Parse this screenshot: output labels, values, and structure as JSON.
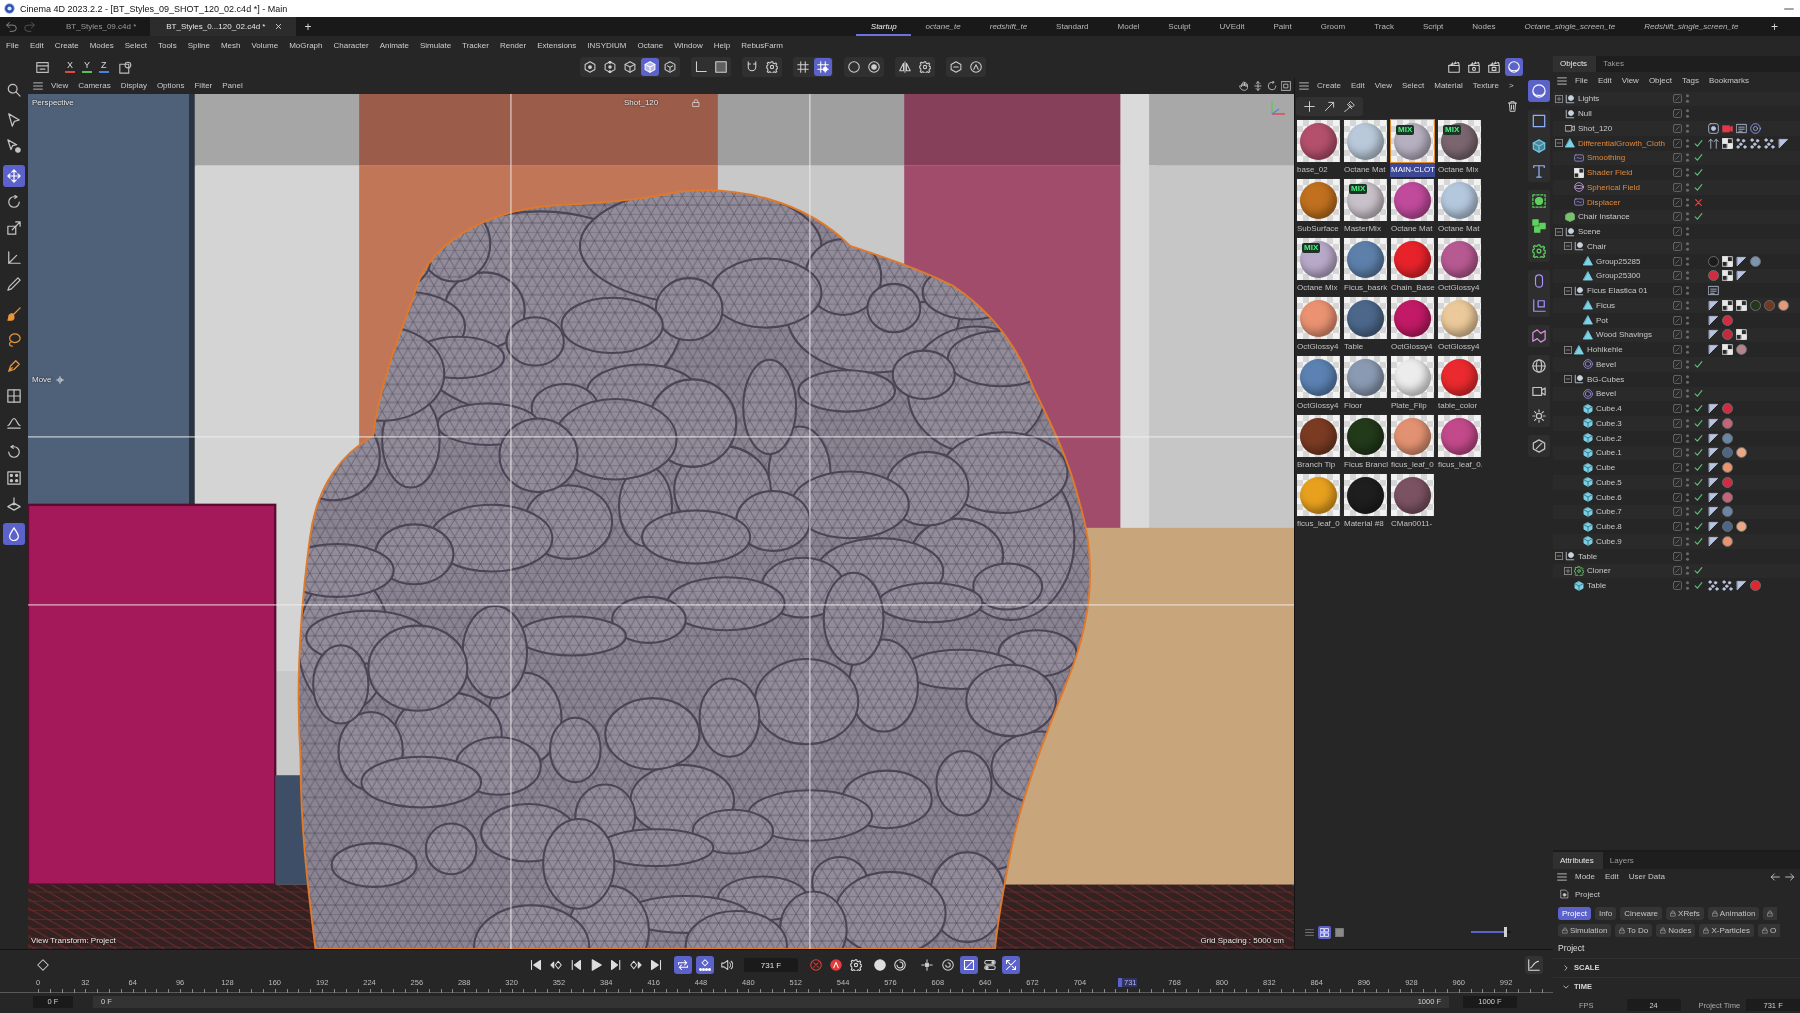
{
  "window": {
    "title": "Cinema 4D 2023.2.2 - [BT_Styles_09_SHOT_120_02.c4d *] - Main"
  },
  "documents": [
    {
      "label": "BT_Styles_09.c4d *",
      "selected": false
    },
    {
      "label": "BT_Styles_0...120_02.c4d *",
      "selected": true
    }
  ],
  "new_document": "+",
  "layouts": [
    {
      "label": "Startup",
      "selected": true,
      "custom": false
    },
    {
      "label": "octane_te",
      "selected": false,
      "custom": true
    },
    {
      "label": "redshift_te",
      "selected": false,
      "custom": true
    },
    {
      "label": "Standard",
      "selected": false,
      "custom": false
    },
    {
      "label": "Model",
      "selected": false,
      "custom": false
    },
    {
      "label": "Sculpt",
      "selected": false,
      "custom": false
    },
    {
      "label": "UVEdit",
      "selected": false,
      "custom": false
    },
    {
      "label": "Paint",
      "selected": false,
      "custom": false
    },
    {
      "label": "Groom",
      "selected": false,
      "custom": false
    },
    {
      "label": "Track",
      "selected": false,
      "custom": false
    },
    {
      "label": "Script",
      "selected": false,
      "custom": false
    },
    {
      "label": "Nodes",
      "selected": false,
      "custom": false
    },
    {
      "label": "Octane_single_screen_te",
      "selected": false,
      "custom": true
    },
    {
      "label": "Redshift_single_screen_te",
      "selected": false,
      "custom": true
    }
  ],
  "new_layout": "+",
  "menu": [
    "File",
    "Edit",
    "Create",
    "Modes",
    "Select",
    "Tools",
    "Spline",
    "Mesh",
    "Volume",
    "MoGraph",
    "Character",
    "Animate",
    "Simulate",
    "Tracker",
    "Render",
    "Extensions",
    "INSYDIUM",
    "Octane",
    "Window",
    "Help",
    "RebusFarm"
  ],
  "toolbar": {
    "axes": [
      {
        "label": "X",
        "color": "#e04848"
      },
      {
        "label": "Y",
        "color": "#58c058"
      },
      {
        "label": "Z",
        "color": "#4a80e0"
      }
    ],
    "tool_groups": [
      [
        {
          "selected": false
        },
        {
          "selected": false
        },
        {
          "selected": false
        },
        {
          "selected": true
        },
        {
          "selected": false
        }
      ],
      [
        {
          "selected": false
        },
        {
          "selected": false
        }
      ],
      [
        {
          "selected": false
        },
        {
          "selected": false
        }
      ],
      [
        {
          "selected": false
        },
        {
          "selected": true
        }
      ],
      [
        {
          "selected": false
        },
        {
          "selected": false
        }
      ],
      [
        {
          "selected": false
        },
        {
          "selected": false
        }
      ],
      [
        {
          "selected": false
        },
        {
          "selected": false
        }
      ]
    ],
    "render_tools": [
      {
        "selected": false
      },
      {
        "selected": false
      },
      {
        "selected": false
      },
      {
        "selected": true
      }
    ]
  },
  "left_tools": [
    [
      {
        "selected": false
      }
    ],
    [
      {
        "selected": false
      },
      {
        "selected": false
      }
    ],
    [
      {
        "selected": true
      },
      {
        "selected": false
      },
      {
        "selected": false
      }
    ],
    [
      {
        "selected": false
      },
      {
        "selected": false
      }
    ],
    [
      {
        "selected": false
      },
      {
        "selected": false
      },
      {
        "selected": false
      }
    ],
    [
      {
        "selected": false
      },
      {
        "selected": false
      }
    ],
    [
      {
        "selected": false
      },
      {
        "selected": false
      },
      {
        "selected": false
      }
    ],
    [
      {
        "selected": true
      }
    ]
  ],
  "viewport": {
    "menu": [
      "View",
      "Cameras",
      "Display",
      "Options",
      "Filter",
      "Panel"
    ],
    "camera": "Perspective",
    "shot": "Shot_120",
    "tool": "Move",
    "view_transform": "View Transform: Project",
    "grid_spacing": "Grid Spacing : 5000 cm"
  },
  "materials": {
    "menu": [
      "Create",
      "Edit",
      "View",
      "Select",
      "Material",
      "Texture",
      ">"
    ],
    "items": [
      {
        "name": "base_02",
        "color": "#b4506c",
        "selected": false
      },
      {
        "name": "Octane Mat",
        "color": "#b9c9d9",
        "selected": false
      },
      {
        "name": "MAIN-CLOT",
        "color": "#b5afbf",
        "badge": "MIX",
        "selected": true
      },
      {
        "name": "Octane Mix",
        "color": "#7b6670",
        "badge": "MIX",
        "selected": false
      },
      {
        "name": "SubSurface",
        "color": "#c0701e",
        "selected": false
      },
      {
        "name": "MasterMix",
        "color": "#c9c1c9",
        "badge": "MIX",
        "selected": false
      },
      {
        "name": "Octane Mat",
        "color": "#c04a9c",
        "selected": false
      },
      {
        "name": "Octane Mat",
        "color": "#b3c7dd",
        "selected": false
      },
      {
        "name": "Octane Mix",
        "color": "#b9a9c9",
        "badge": "MIX",
        "selected": false
      },
      {
        "name": "Ficus_basrk",
        "color": "#5d80aa",
        "selected": false
      },
      {
        "name": "Chain_Base",
        "color": "#e8222a",
        "selected": false
      },
      {
        "name": "OctGlossy4",
        "color": "#b85a92",
        "selected": false
      },
      {
        "name": "OctGlossy4",
        "color": "#ea9272",
        "selected": false
      },
      {
        "name": "Table",
        "color": "#4b678a",
        "selected": false
      },
      {
        "name": "OctGlossy4",
        "color": "#c21a66",
        "selected": false
      },
      {
        "name": "OctGlossy4",
        "color": "#ebc99a",
        "selected": false
      },
      {
        "name": "OctGlossy4",
        "color": "#5b82b2",
        "selected": false
      },
      {
        "name": "Floor",
        "color": "#8a9ab2",
        "selected": false
      },
      {
        "name": "Plate_Flip",
        "color": "#ececec",
        "selected": false
      },
      {
        "name": "table_color",
        "color": "#ea2a2e",
        "selected": false
      },
      {
        "name": "Branch Tip",
        "color": "#7a3b22",
        "selected": false
      },
      {
        "name": "Ficus Brancl",
        "color": "#22391a",
        "selected": false
      },
      {
        "name": "ficus_leaf_0",
        "color": "#e29272",
        "selected": false
      },
      {
        "name": "ficus_leaf_0.",
        "color": "#c24a8a",
        "selected": false
      },
      {
        "name": "ficus_leaf_0",
        "color": "#e8a11e",
        "selected": false
      },
      {
        "name": "Material #8",
        "color": "#1e1e1e",
        "selected": false
      },
      {
        "name": "CMan0011-",
        "color": "#7b5262",
        "selected": false
      }
    ],
    "view_modes": [
      {
        "selected": false
      },
      {
        "selected": true
      },
      {
        "selected": false
      }
    ],
    "thumbnail_size": {
      "level": 0.85
    }
  },
  "right_tools": [
    [
      {
        "selected": true
      }
    ],
    [
      {
        "selected": false
      },
      {
        "selected": false
      },
      {
        "selected": false
      }
    ],
    [
      {
        "selected": false
      },
      {
        "selected": false
      },
      {
        "selected": false
      }
    ],
    [
      {
        "selected": false
      },
      {
        "selected": false
      }
    ],
    [
      {
        "selected": false
      }
    ],
    [
      {
        "selected": false
      },
      {
        "selected": false
      },
      {
        "selected": false
      }
    ],
    [
      {
        "selected": false
      }
    ]
  ],
  "objects": {
    "tabs": [
      {
        "label": "Objects",
        "selected": true
      },
      {
        "label": "Takes",
        "selected": false
      }
    ],
    "menu": [
      "File",
      "Edit",
      "View",
      "Object",
      "Tags",
      "Bookmarks"
    ],
    "tree": [
      {
        "name": "Lights",
        "kind": "null",
        "expanded": false,
        "selected": false
      },
      {
        "name": "Null",
        "kind": "null",
        "selected": false
      },
      {
        "name": "Shot_120",
        "kind": "camera",
        "selected": false,
        "tags": [
          {
            "kind": "target"
          },
          {
            "kind": "camera"
          },
          {
            "kind": "note"
          },
          {
            "kind": "ring"
          }
        ]
      },
      {
        "name": "DifferentialGrowth_Cloth",
        "kind": "mesh",
        "expanded": true,
        "selected": true,
        "enabled": true,
        "tags": [
          {
            "kind": "arrows"
          },
          {
            "kind": "checker"
          },
          {
            "kind": "dots"
          },
          {
            "kind": "dots"
          },
          {
            "kind": "dots"
          },
          {
            "kind": "triangle"
          }
        ],
        "children": [
          {
            "name": "Smoothing",
            "kind": "deformer",
            "selected": true,
            "enabled": true
          },
          {
            "name": "Shader Field",
            "kind": "checkerfield",
            "selected": true,
            "enabled": true
          },
          {
            "name": "Spherical Field",
            "kind": "spherefield",
            "selected": true,
            "enabled": true
          },
          {
            "name": "Displacer",
            "kind": "deformer",
            "selected": true,
            "enabled": false
          }
        ]
      },
      {
        "name": "Chair Instance",
        "kind": "instance",
        "selected": false,
        "enabled": true
      },
      {
        "name": "Scene",
        "kind": "null",
        "expanded": true,
        "selected": false,
        "children": [
          {
            "name": "Chair",
            "kind": "null",
            "expanded": true,
            "selected": false,
            "children": [
              {
                "name": "Group25285",
                "kind": "mesh",
                "selected": false,
                "tags": [
                  {
                    "kind": "material",
                    "color": "#1c1c1c"
                  },
                  {
                    "kind": "checker"
                  },
                  {
                    "kind": "triangle"
                  },
                  {
                    "kind": "material",
                    "color": "#7c94ac"
                  }
                ]
              },
              {
                "name": "Group25300",
                "kind": "mesh",
                "selected": false,
                "tags": [
                  {
                    "kind": "material",
                    "color": "#d42a40"
                  },
                  {
                    "kind": "checker"
                  },
                  {
                    "kind": "triangle"
                  }
                ]
              }
            ]
          },
          {
            "name": "Ficus Elastica 01",
            "kind": "null",
            "expanded": true,
            "selected": false,
            "tags": [
              {
                "kind": "note"
              }
            ],
            "children": [
              {
                "name": "Ficus",
                "kind": "mesh",
                "selected": false,
                "tags": [
                  {
                    "kind": "triangle"
                  },
                  {
                    "kind": "checker"
                  },
                  {
                    "kind": "checker"
                  },
                  {
                    "kind": "material",
                    "color": "#24361e"
                  },
                  {
                    "kind": "material",
                    "color": "#6e3a22"
                  },
                  {
                    "kind": "material",
                    "color": "#e29a78"
                  }
                ]
              },
              {
                "name": "Pot",
                "kind": "mesh",
                "selected": false,
                "tags": [
                  {
                    "kind": "triangle"
                  },
                  {
                    "kind": "material",
                    "color": "#d42a40"
                  }
                ]
              },
              {
                "name": "Wood Shavings",
                "kind": "mesh",
                "selected": false,
                "tags": [
                  {
                    "kind": "triangle"
                  },
                  {
                    "kind": "material",
                    "color": "#c8283c"
                  },
                  {
                    "kind": "checker"
                  }
                ]
              }
            ]
          },
          {
            "name": "Hohlkehle",
            "kind": "mesh",
            "expanded": true,
            "selected": false,
            "tags": [
              {
                "kind": "triangle"
              },
              {
                "kind": "checker"
              },
              {
                "kind": "material",
                "color": "#b4848a"
              }
            ],
            "children": [
              {
                "name": "Bevel",
                "kind": "bevel",
                "selected": false,
                "enabled": true
              }
            ]
          },
          {
            "name": "BG-Cubes",
            "kind": "null",
            "expanded": true,
            "selected": false,
            "children": [
              {
                "name": "Bevel",
                "kind": "bevel",
                "selected": false,
                "enabled": true
              },
              {
                "name": "Cube.4",
                "kind": "cube",
                "selected": false,
                "enabled": true,
                "tags": [
                  {
                    "kind": "triangle"
                  },
                  {
                    "kind": "material",
                    "color": "#d22a44"
                  }
                ]
              },
              {
                "name": "Cube.3",
                "kind": "cube",
                "selected": false,
                "enabled": true,
                "tags": [
                  {
                    "kind": "triangle"
                  },
                  {
                    "kind": "material",
                    "color": "#c46478"
                  }
                ]
              },
              {
                "name": "Cube.2",
                "kind": "cube",
                "selected": false,
                "enabled": true,
                "tags": [
                  {
                    "kind": "triangle"
                  },
                  {
                    "kind": "material",
                    "color": "#6a86a6"
                  }
                ]
              },
              {
                "name": "Cube.1",
                "kind": "cube",
                "selected": false,
                "enabled": true,
                "tags": [
                  {
                    "kind": "triangle"
                  },
                  {
                    "kind": "material",
                    "color": "#4c6686"
                  },
                  {
                    "kind": "material",
                    "color": "#eaa884"
                  }
                ]
              },
              {
                "name": "Cube",
                "kind": "cube",
                "selected": false,
                "enabled": true,
                "tags": [
                  {
                    "kind": "triangle"
                  },
                  {
                    "kind": "material",
                    "color": "#e8946e"
                  }
                ]
              },
              {
                "name": "Cube.5",
                "kind": "cube",
                "selected": false,
                "enabled": true,
                "tags": [
                  {
                    "kind": "triangle"
                  },
                  {
                    "kind": "material",
                    "color": "#d22a44"
                  }
                ]
              },
              {
                "name": "Cube.6",
                "kind": "cube",
                "selected": false,
                "enabled": true,
                "tags": [
                  {
                    "kind": "triangle"
                  },
                  {
                    "kind": "material",
                    "color": "#c46478"
                  }
                ]
              },
              {
                "name": "Cube.7",
                "kind": "cube",
                "selected": false,
                "enabled": true,
                "tags": [
                  {
                    "kind": "triangle"
                  },
                  {
                    "kind": "material",
                    "color": "#6a86a6"
                  }
                ]
              },
              {
                "name": "Cube.8",
                "kind": "cube",
                "selected": false,
                "enabled": true,
                "tags": [
                  {
                    "kind": "triangle"
                  },
                  {
                    "kind": "material",
                    "color": "#4c6686"
                  },
                  {
                    "kind": "material",
                    "color": "#eaa884"
                  }
                ]
              },
              {
                "name": "Cube.9",
                "kind": "cube",
                "selected": false,
                "enabled": true,
                "tags": [
                  {
                    "kind": "triangle"
                  },
                  {
                    "kind": "material",
                    "color": "#e8946e"
                  }
                ]
              }
            ]
          }
        ]
      },
      {
        "name": "Table",
        "kind": "null",
        "expanded": true,
        "selected": false,
        "children": [
          {
            "name": "Cloner",
            "kind": "cloner",
            "expanded": false,
            "selected": false,
            "enabled": true
          },
          {
            "name": "Table",
            "kind": "cube",
            "selected": false,
            "enabled": true,
            "tags": [
              {
                "kind": "dots"
              },
              {
                "kind": "dots"
              },
              {
                "kind": "triangle"
              },
              {
                "kind": "material",
                "color": "#e0262e"
              }
            ]
          }
        ]
      }
    ]
  },
  "attributes": {
    "tabs": [
      {
        "label": "Attributes",
        "selected": true
      },
      {
        "label": "Layers",
        "selected": false
      }
    ],
    "menu": [
      "Mode",
      "Edit",
      "User Data"
    ],
    "object": "Project",
    "button_rows": [
      [
        {
          "label": "Project",
          "selected": true,
          "locked": false
        },
        {
          "label": "Info",
          "selected": false,
          "locked": false
        },
        {
          "label": "Cineware",
          "selected": false,
          "locked": false
        },
        {
          "label": "XRefs",
          "selected": false,
          "locked": true
        },
        {
          "label": "Animation",
          "selected": false,
          "locked": true
        },
        {
          "selected": false,
          "locked": true
        }
      ],
      [
        {
          "label": "Simulation",
          "selected": false,
          "locked": true
        },
        {
          "label": "To Do",
          "selected": false,
          "locked": true
        },
        {
          "label": "Nodes",
          "selected": false,
          "locked": true
        },
        {
          "label": "X-Particles",
          "selected": false,
          "locked": true
        },
        {
          "label": "O",
          "selected": false,
          "locked": true
        }
      ]
    ],
    "section": "Project",
    "groups": [
      {
        "label": "SCALE",
        "expanded": false
      },
      {
        "label": "TIME",
        "expanded": true
      }
    ],
    "fields": [
      {
        "label": "FPS",
        "value": "24"
      },
      {
        "label": "Project Time",
        "value": "731 F"
      }
    ]
  },
  "timeline": {
    "playback_modes": [
      {
        "selected": true
      },
      {
        "selected": true
      },
      {
        "selected": false
      }
    ],
    "frame": "731 F",
    "key_tools": [
      {
        "selected": false
      },
      {
        "selected": false
      },
      {
        "selected": true
      },
      {
        "selected": false
      },
      {
        "selected": true
      }
    ],
    "ruler": [
      {
        "label": "0",
        "selected": false
      },
      {
        "label": "32",
        "selected": false
      },
      {
        "label": "64",
        "selected": false
      },
      {
        "label": "96",
        "selected": false
      },
      {
        "label": "128",
        "selected": false
      },
      {
        "label": "160",
        "selected": false
      },
      {
        "label": "192",
        "selected": false
      },
      {
        "label": "224",
        "selected": false
      },
      {
        "label": "256",
        "selected": false
      },
      {
        "label": "288",
        "selected": false
      },
      {
        "label": "320",
        "selected": false
      },
      {
        "label": "352",
        "selected": false
      },
      {
        "label": "384",
        "selected": false
      },
      {
        "label": "416",
        "selected": false
      },
      {
        "label": "448",
        "selected": false
      },
      {
        "label": "480",
        "selected": false
      },
      {
        "label": "512",
        "selected": false
      },
      {
        "label": "544",
        "selected": false
      },
      {
        "label": "576",
        "selected": false
      },
      {
        "label": "608",
        "selected": false
      },
      {
        "label": "640",
        "selected": false
      },
      {
        "label": "672",
        "selected": false
      },
      {
        "label": "704",
        "selected": false
      },
      {
        "label": "731",
        "selected": true
      },
      {
        "label": "768",
        "selected": false
      },
      {
        "label": "800",
        "selected": false
      },
      {
        "label": "832",
        "selected": false
      },
      {
        "label": "864",
        "selected": false
      },
      {
        "label": "896",
        "selected": false
      },
      {
        "label": "928",
        "selected": false
      },
      {
        "label": "960",
        "selected": false
      },
      {
        "label": "992",
        "selected": false
      }
    ],
    "start": "0 F",
    "range_start": "0 F",
    "range_end": "1000 F",
    "end": "1000 F"
  }
}
